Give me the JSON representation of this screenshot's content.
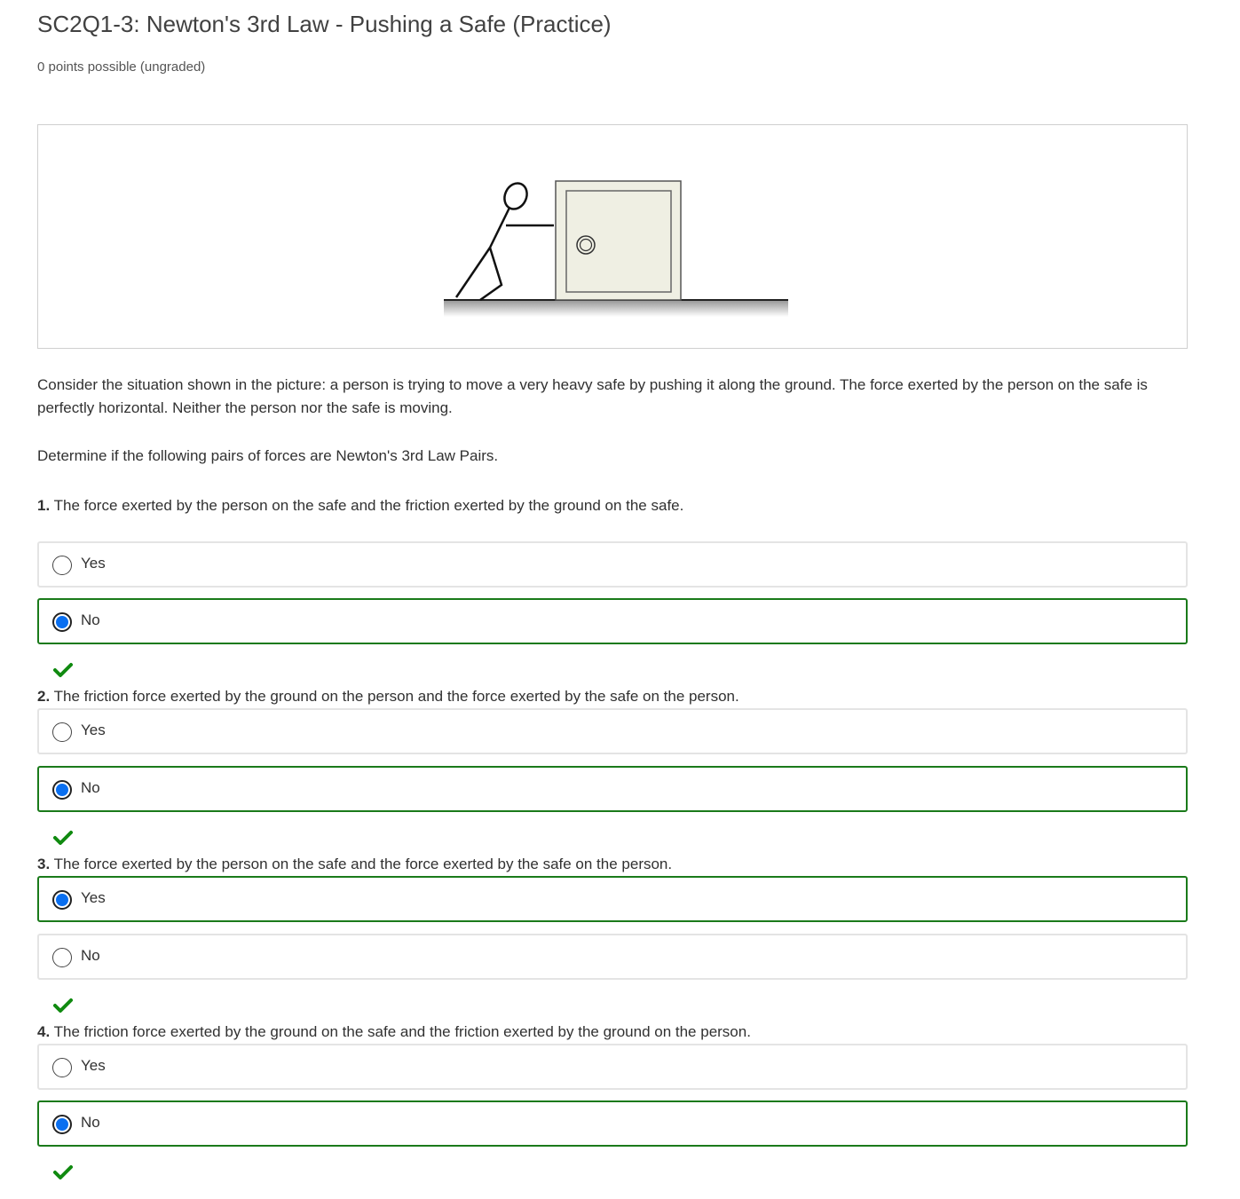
{
  "problem": {
    "title": "SC2Q1-3: Newton's 3rd Law - Pushing a Safe (Practice)",
    "points": "0 points possible (ungraded)"
  },
  "figure": {
    "icon": "person-pushing-safe-illustration"
  },
  "prompt": {
    "situation": "Consider the situation shown in the picture: a person is trying to move a very heavy safe by pushing it along the ground. The force exerted by the person on the safe is perfectly horizontal. Neither the person nor the safe is moving.",
    "instruction": "Determine if the following pairs of forces are Newton's 3rd Law Pairs."
  },
  "questions": [
    {
      "number": "1.",
      "text": "The force exerted by the person on the safe and the friction exerted by the ground on the safe.",
      "choices": [
        {
          "label": "Yes",
          "selected": false
        },
        {
          "label": "No",
          "selected": true
        }
      ],
      "status": "correct"
    },
    {
      "number": "2.",
      "text": "The friction force exerted by the ground on the person and the force exerted by the safe on the person.",
      "choices": [
        {
          "label": "Yes",
          "selected": false
        },
        {
          "label": "No",
          "selected": true
        }
      ],
      "status": "correct"
    },
    {
      "number": "3.",
      "text": "The force exerted by the person on the safe and the force exerted by the safe on the person.",
      "choices": [
        {
          "label": "Yes",
          "selected": true
        },
        {
          "label": "No",
          "selected": false
        }
      ],
      "status": "correct"
    },
    {
      "number": "4.",
      "text": "The friction force exerted by the ground on the safe and the friction exerted by the ground on the person.",
      "choices": [
        {
          "label": "Yes",
          "selected": false
        },
        {
          "label": "No",
          "selected": true
        }
      ],
      "status": "correct"
    }
  ],
  "colors": {
    "correct_border": "#1a7a1a",
    "checkmark": "#108a10",
    "radio_fill": "#0a6ff0",
    "default_border": "#e4e4e4"
  },
  "icons": {
    "radio_checked": "radio-selected-icon",
    "radio_unchecked": "radio-empty-icon",
    "status": "checkmark-icon"
  }
}
